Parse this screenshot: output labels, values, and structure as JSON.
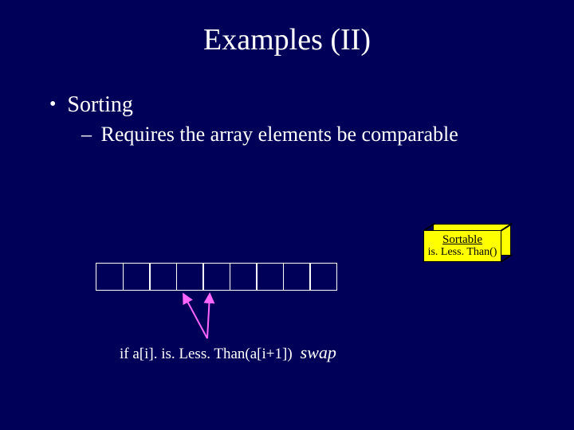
{
  "title": "Examples (II)",
  "bullet1": "Sorting",
  "bullet2": "Requires the array elements be comparable",
  "box": {
    "line1": "Sortable",
    "line2": "is. Less. Than()"
  },
  "code": {
    "cond": "if a[i]. is. Less. Than(a[i+1])",
    "swap": "swap"
  }
}
